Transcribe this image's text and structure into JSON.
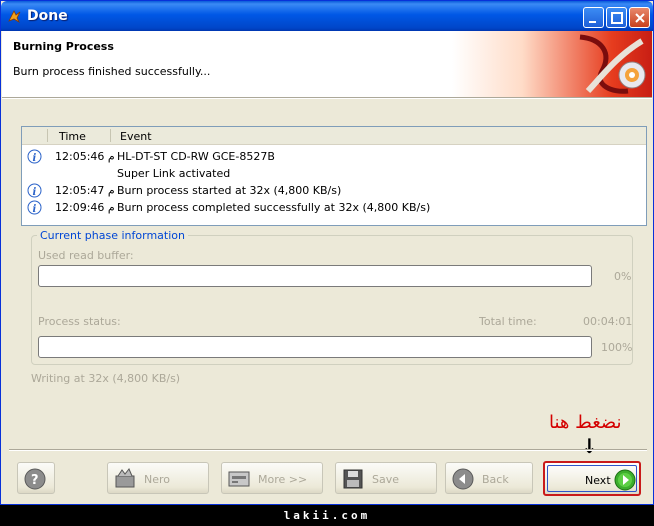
{
  "window": {
    "title": "Done",
    "accent": "#0058e6"
  },
  "header": {
    "title": "Burning Process",
    "subtitle": "Burn process finished successfully..."
  },
  "log": {
    "columns": [
      "Time",
      "Event"
    ],
    "rows": [
      {
        "icon": "info-icon",
        "time": "12:05:46 م",
        "event": "HL-DT-ST CD-RW GCE-8527B"
      },
      {
        "icon": "",
        "time": "",
        "event": "Super Link activated"
      },
      {
        "icon": "info-icon",
        "time": "12:05:47 م",
        "event": "Burn process started at 32x (4,800 KB/s)"
      },
      {
        "icon": "info-icon",
        "time": "12:09:46 م",
        "event": "Burn process completed successfully at 32x (4,800 KB/s)"
      }
    ]
  },
  "phase": {
    "legend": "Current phase information",
    "buffer_label": "Used read buffer:",
    "buffer_value": "0%",
    "buffer_fraction": 0,
    "status_label": "Process status:",
    "total_time_label": "Total time:",
    "total_time_value": "00:04:01",
    "status_value": "100%",
    "status_fraction": 1.0,
    "writing_text": "Writing at 32x (4,800 KB/s)"
  },
  "buttons": {
    "nero": "Nero",
    "more": "More >>",
    "save": "Save",
    "back": "Back",
    "next": "Next"
  },
  "annotation": {
    "arabic": "نضغط هنا",
    "arrow": "↓",
    "color": "#d40000"
  },
  "footer": {
    "text": "lakii.com"
  }
}
